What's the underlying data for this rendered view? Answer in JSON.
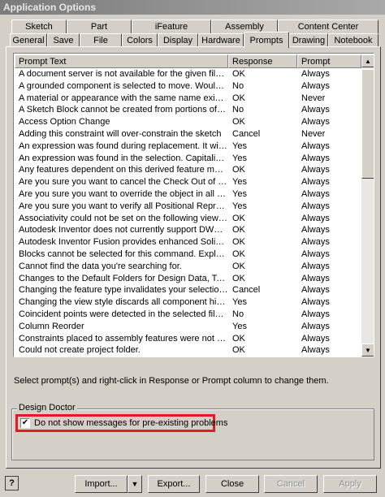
{
  "window": {
    "title": "Application Options"
  },
  "tabs_back": [
    {
      "label": "Sketch"
    },
    {
      "label": "Part"
    },
    {
      "label": "iFeature"
    },
    {
      "label": "Assembly"
    },
    {
      "label": "Content Center"
    }
  ],
  "tabs_front": [
    {
      "label": "General"
    },
    {
      "label": "Save"
    },
    {
      "label": "File"
    },
    {
      "label": "Colors"
    },
    {
      "label": "Display"
    },
    {
      "label": "Hardware"
    },
    {
      "label": "Prompts"
    },
    {
      "label": "Drawing"
    },
    {
      "label": "Notebook"
    }
  ],
  "active_tab": "Prompts",
  "list": {
    "headers": [
      "Prompt Text",
      "Response",
      "Prompt"
    ],
    "rows": [
      [
        "A document server is not available for the given file.  T...",
        "OK",
        "Always"
      ],
      [
        "A grounded component is selected to move. Would you...",
        "No",
        "Always"
      ],
      [
        "A material or appearance with the same name exists in...",
        "OK",
        "Never"
      ],
      [
        "A Sketch Block cannot be created from portions of a Pa...",
        "No",
        "Always"
      ],
      [
        "Access Option Change",
        "OK",
        "Always"
      ],
      [
        "Adding this constraint will over-constrain the sketch",
        "Cancel",
        "Never"
      ],
      [
        "An expression was found during replacement. It will be ...",
        "Yes",
        "Always"
      ],
      [
        "An expression was found in the selection. Capitalize will r...",
        "Yes",
        "Always"
      ],
      [
        "Any features dependent on this derived feature may b...",
        "OK",
        "Always"
      ],
      [
        "Are you sure you want to cancel the Check Out of %s?",
        "Yes",
        "Always"
      ],
      [
        "Are you sure you want to override the object in all of th...",
        "Yes",
        "Always"
      ],
      [
        "Are you sure you want to verify all Positional Represent...",
        "Yes",
        "Always"
      ],
      [
        "Associativity could not be set on the following views bec...",
        "OK",
        "Always"
      ],
      [
        "Autodesk Inventor does not currently support DWF/DG...",
        "OK",
        "Always"
      ],
      [
        "Autodesk Inventor Fusion provides enhanced Solid Edit ...",
        "OK",
        "Always"
      ],
      [
        "Blocks cannot be selected for this command. Explode t...",
        "OK",
        "Always"
      ],
      [
        "Cannot find the data you're searching for.",
        "OK",
        "Always"
      ],
      [
        "Changes to the Default Folders for Design Data, Templ...",
        "OK",
        "Always"
      ],
      [
        "Changing the feature type invalidates your selections an...",
        "Cancel",
        "Always"
      ],
      [
        "Changing the view style discards all component hidden li...",
        "Yes",
        "Always"
      ],
      [
        "Coincident points were detected in the selected file. Zer...",
        "No",
        "Always"
      ],
      [
        "Column Reorder",
        "Yes",
        "Always"
      ],
      [
        "Constraints placed to assembly features were not conv...",
        "OK",
        "Always"
      ],
      [
        "Could not create project folder.",
        "OK",
        "Always"
      ]
    ]
  },
  "instruction": "Select prompt(s) and right-click in Response or Prompt column to change them.",
  "design_doctor": {
    "group_label": "Design Doctor",
    "checkbox_label": "Do not show messages for pre-existing problems",
    "checked": "✔"
  },
  "buttons": {
    "help": "?",
    "import": "Import...",
    "export": "Export...",
    "close": "Close",
    "cancel": "Cancel",
    "apply": "Apply"
  },
  "icons": {
    "scroll_up": "▲",
    "scroll_down": "▼",
    "dropdown": "▼"
  }
}
